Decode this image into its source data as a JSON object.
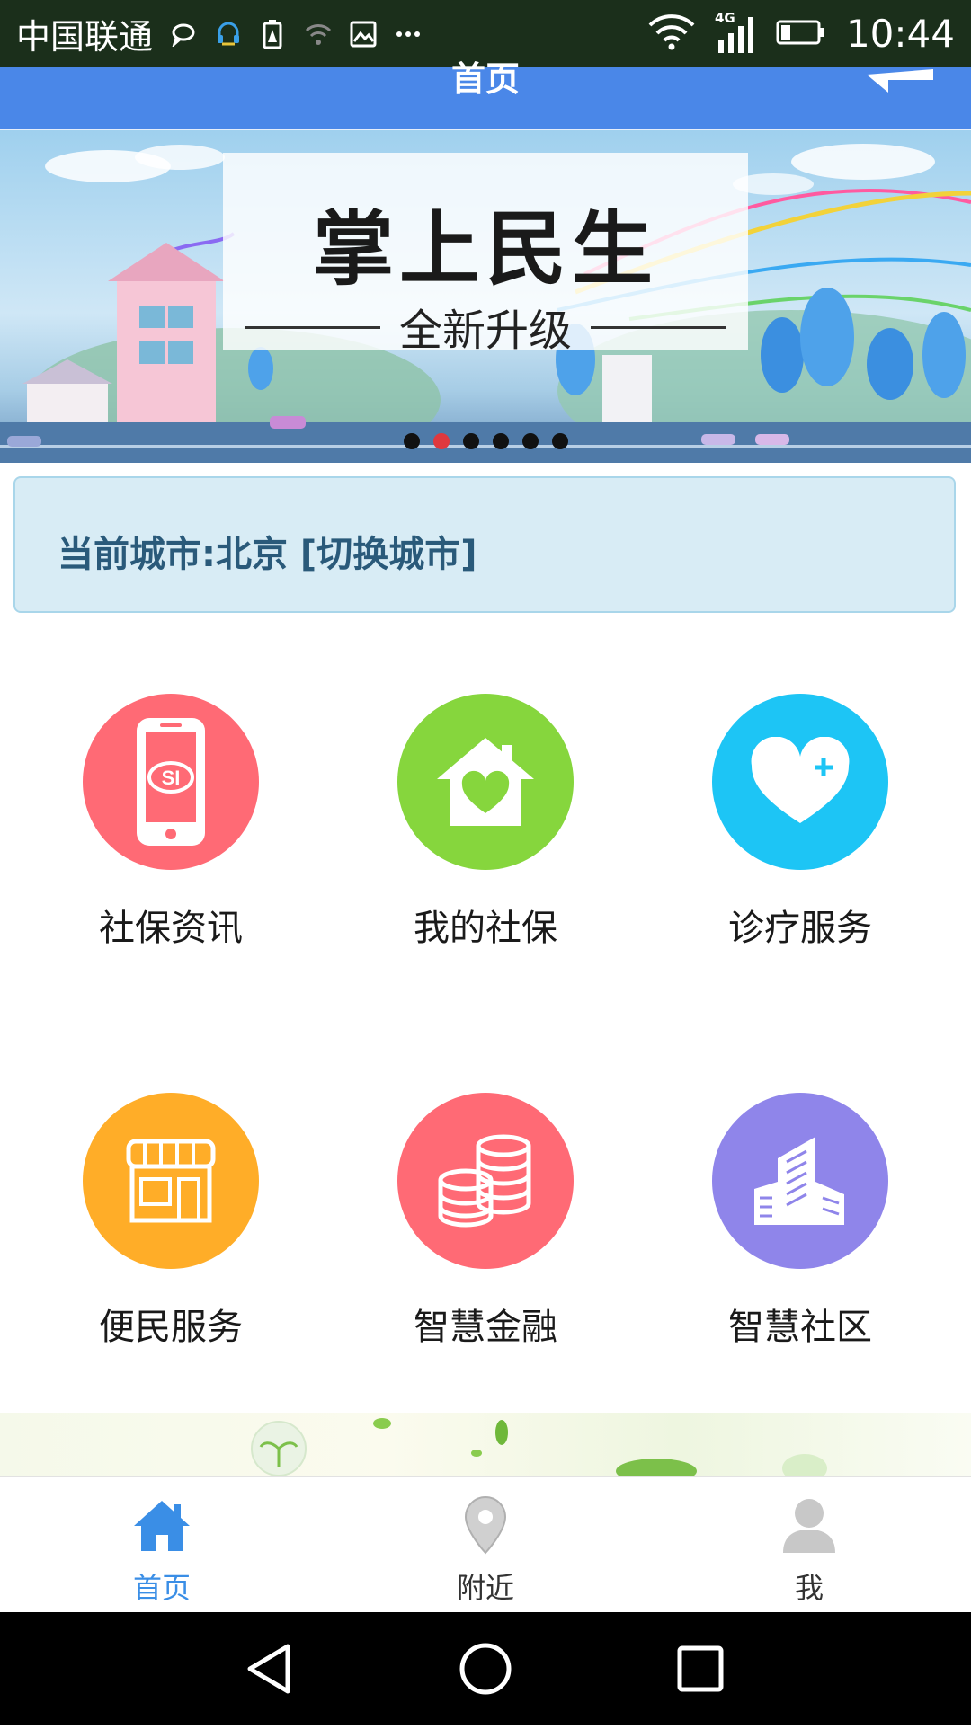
{
  "status_bar": {
    "carrier": "中国联通",
    "time": "10:44",
    "network": "4G"
  },
  "header": {
    "title": "首页"
  },
  "banner": {
    "title": "掌上民生",
    "subtitle": "全新升级",
    "slide_count": 6,
    "active_slide": 2
  },
  "city": {
    "label": "当前城市:北京 [切换城市]"
  },
  "services": [
    {
      "label": "社保资讯",
      "color": "#ff6a75",
      "icon": "phone-si-icon"
    },
    {
      "label": "我的社保",
      "color": "#86d63d",
      "icon": "house-heart-icon"
    },
    {
      "label": "诊疗服务",
      "color": "#1dc5f5",
      "icon": "heart-plus-icon"
    },
    {
      "label": "便民服务",
      "color": "#ffad28",
      "icon": "storefront-icon"
    },
    {
      "label": "智慧金融",
      "color": "#ff6a75",
      "icon": "coins-icon"
    },
    {
      "label": "智慧社区",
      "color": "#8f85ea",
      "icon": "buildings-icon"
    }
  ],
  "tabs": [
    {
      "label": "首页",
      "icon": "home-icon",
      "active": true,
      "color": "#3a8ee6"
    },
    {
      "label": "附近",
      "icon": "location-pin-icon",
      "active": false,
      "color": "#333333"
    },
    {
      "label": "我",
      "icon": "user-icon",
      "active": false,
      "color": "#333333"
    }
  ]
}
